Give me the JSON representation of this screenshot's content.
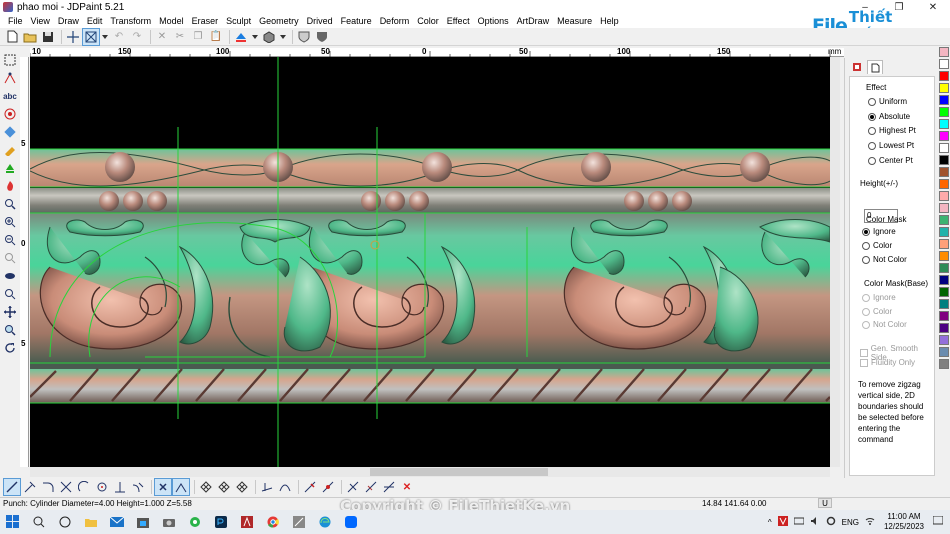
{
  "window": {
    "title": "phao moi - JDPaint 5.21",
    "minimize": "–",
    "maximize": "❐",
    "close": "✕"
  },
  "menu": [
    "File",
    "View",
    "Draw",
    "Edit",
    "Transform",
    "Model",
    "Eraser",
    "Sculpt",
    "Geometry",
    "Drived",
    "Feature",
    "Deform",
    "Color",
    "Effect",
    "Options",
    "ArtDraw",
    "Measure",
    "Help"
  ],
  "logo": {
    "mark": "File",
    "text": "Thiết Kế.vn"
  },
  "ruler": {
    "top_labels": [
      "10",
      "150",
      "100",
      "50",
      "0",
      "50",
      "100",
      "150"
    ],
    "left_labels": [
      "5",
      "0",
      "5"
    ],
    "unit": "mm"
  },
  "panel": {
    "effect": {
      "title": "Effect",
      "options": [
        "Uniform",
        "Absolute",
        "Highest Pt",
        "Lowest Pt",
        "Center Pt"
      ],
      "selected": "Absolute"
    },
    "height": {
      "label": "Height(+/-)",
      "value": "0"
    },
    "color_mask": {
      "title": "Color Mask",
      "options": [
        "Ignore",
        "Color",
        "Not Color"
      ],
      "selected": "Ignore"
    },
    "color_mask_base": {
      "title": "Color Mask(Base)",
      "options": [
        "Ignore",
        "Color",
        "Not Color"
      ]
    },
    "checks": [
      "Gen. Smooth Side",
      "Fluidity Only"
    ],
    "hint": "To remove zigzag vertical side, 2D boundaries should be selected before entering the command"
  },
  "palette": [
    "#f4b6c2",
    "#ffffff",
    "#ff0000",
    "#ffff00",
    "#0000ff",
    "#00ff00",
    "#00ffff",
    "#ff00ff",
    "#ffffff",
    "#000000",
    "#a0522d",
    "#ff6600",
    "#ffaaaa",
    "#f4b6c2",
    "#3cb371",
    "#20b2aa",
    "#ffa07a",
    "#ff8c00",
    "#2e8b57",
    "#000080",
    "#006400",
    "#008080",
    "#800080",
    "#4b0082",
    "#9370db",
    "#6a8caf",
    "#808080"
  ],
  "status": {
    "command": "Punch: Cylinder  Diameter=4.00  Height=1.000  Z=5.58",
    "coords": "14.84  141.64  0.00",
    "unit": "U"
  },
  "watermark": "Copyright © FileThietKe.vn",
  "taskbar": {
    "language": "ENG",
    "time": "11:00 AM",
    "date": "12/25/2023"
  }
}
